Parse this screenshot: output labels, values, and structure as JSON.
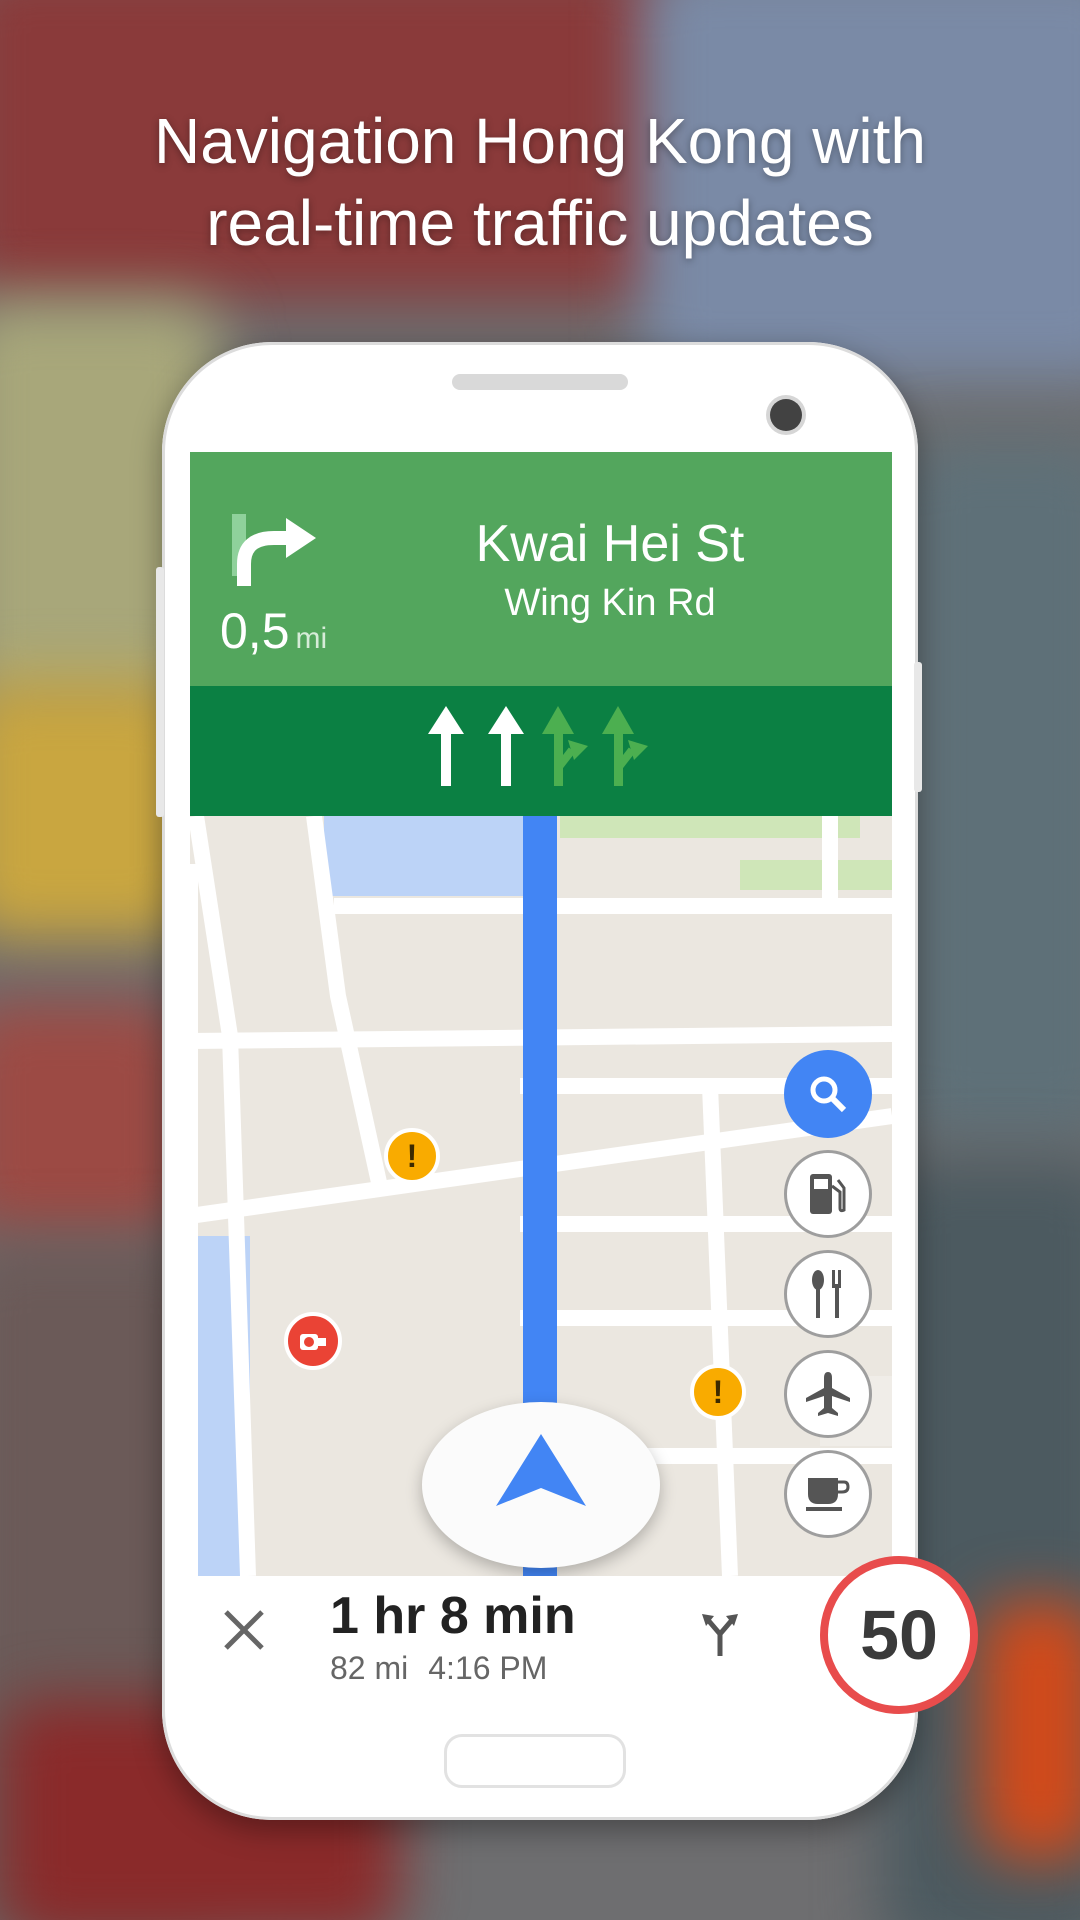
{
  "headline": {
    "line1": "Navigation Hong Kong with",
    "line2": "real-time traffic updates"
  },
  "nav": {
    "distance_value": "0,5",
    "distance_unit": "mi",
    "street": "Kwai Hei St",
    "cross_street": "Wing Kin Rd",
    "maneuver_icon": "turn-right-icon",
    "lanes": [
      {
        "icon": "lane-straight-icon",
        "active": true
      },
      {
        "icon": "lane-straight-icon",
        "active": true
      },
      {
        "icon": "lane-straight-right-icon",
        "active": false
      },
      {
        "icon": "lane-straight-right-icon",
        "active": false
      }
    ],
    "colors": {
      "header": "#53a65d",
      "lanes": "#0b8043",
      "route": "#4285f4"
    }
  },
  "map_buttons": [
    "search-icon",
    "gas-station-icon",
    "restaurant-icon",
    "airport-icon",
    "coffee-icon"
  ],
  "trip": {
    "duration": "1 hr 8 min",
    "distance": "82 mi",
    "arrival": "4:16 PM"
  },
  "speed_limit": "50"
}
